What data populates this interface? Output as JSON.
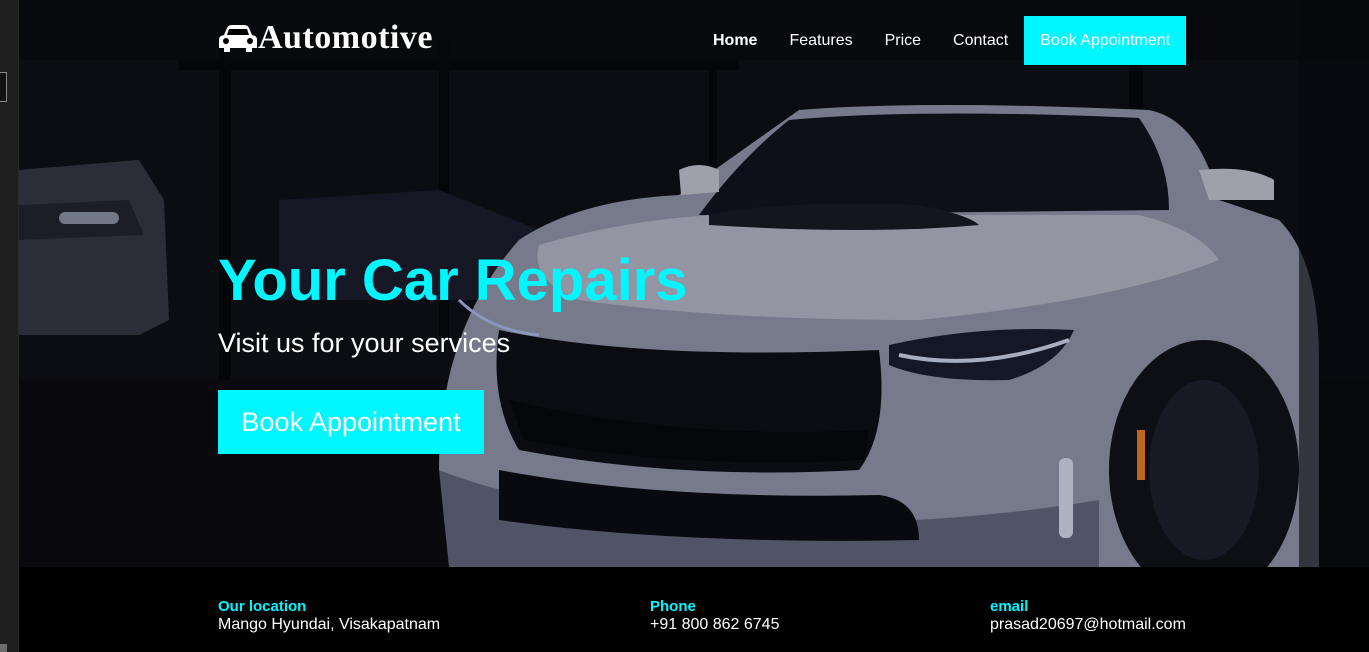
{
  "brand": {
    "name": "Automotive",
    "icon": "car-icon"
  },
  "nav": {
    "items": [
      {
        "label": "Home",
        "active": true
      },
      {
        "label": "Features",
        "active": false
      },
      {
        "label": "Price",
        "active": false
      },
      {
        "label": "Contact",
        "active": false
      }
    ],
    "cta_label": "Book Appointment"
  },
  "hero": {
    "title": "Your Car Repairs",
    "subtitle": "Visit us for your services",
    "cta_label": "Book Appointment"
  },
  "footer": {
    "location": {
      "label": "Our location",
      "value": "Mango Hyundai, Visakapatnam"
    },
    "phone": {
      "label": "Phone",
      "value": "+91 800 862 6745"
    },
    "email": {
      "label": "email",
      "value": "prasad20697@hotmail.com"
    }
  },
  "colors": {
    "accent": "#00f7ff",
    "background": "#000000",
    "text": "#ffffff"
  }
}
